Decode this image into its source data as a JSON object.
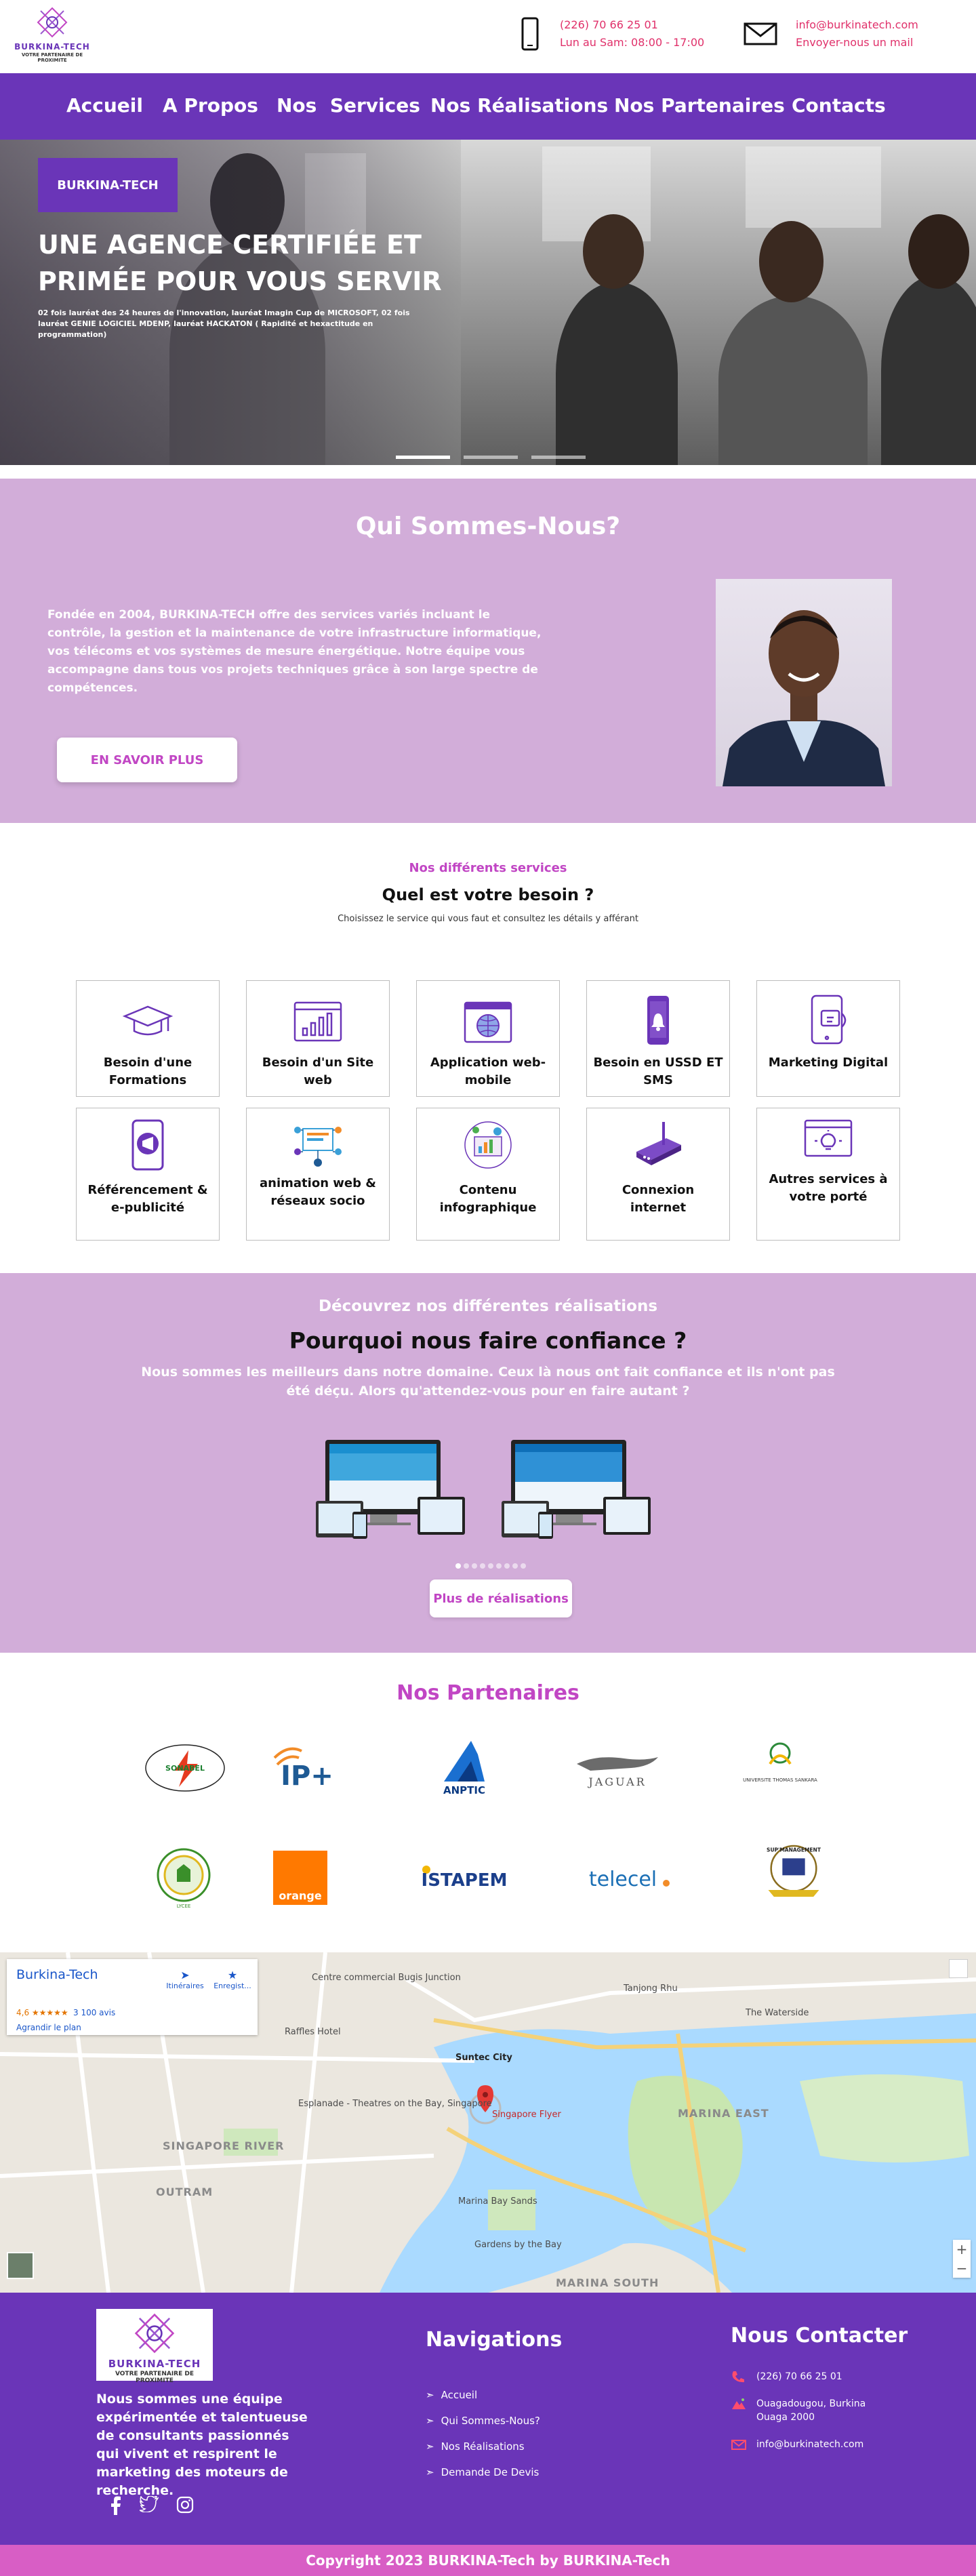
{
  "brand": {
    "name": "BURKINA-TECH",
    "tagline": "VOTRE PARTENAIRE DE PROXIMITE"
  },
  "header": {
    "phone": "(226) 70 66 25 01",
    "hours": "Lun au Sam: 08:00 - 17:00",
    "email": "info@burkinatech.com",
    "email_cta": "Envoyer-nous un mail"
  },
  "nav": {
    "items": [
      "Accueil",
      "A Propos",
      "Nos  Services",
      "Nos Réalisations",
      "Nos Partenaires",
      "Contacts"
    ]
  },
  "hero": {
    "tag": "BURKINA-TECH",
    "title": "UNE AGENCE CERTIFIÉE ET PRIMÉE POUR VOUS SERVIR",
    "subtitle": "02 fois lauréat des 24 heures de l'innovation, lauréat Imagin Cup de MICROSOFT, 02 fois lauréat GENIE LOGICIEL MDENP, lauréat HACKATON ( Rapidité et hexactitude en programmation)",
    "slide_count": 3,
    "active_slide": 1
  },
  "about": {
    "title": "Qui Sommes-Nous?",
    "text": "Fondée en 2004, BURKINA-TECH offre des services variés incluant le contrôle, la gestion et la maintenance de votre infrastructure informatique, vos télécoms et vos systèmes de mesure énergétique. Notre équipe vous accompagne dans tous vos projets techniques grâce à son large spectre de compétences.",
    "button": "EN SAVOIR PLUS"
  },
  "services": {
    "kicker": "Nos différents services",
    "title": "Quel est votre besoin ?",
    "subtitle": "Choisissez le service qui vous faut et consultez les détails y afférant",
    "items": [
      {
        "label": "Besoin d'une Formations",
        "icon": "graduation-cap-icon"
      },
      {
        "label": "Besoin d'un Site web",
        "icon": "website-chart-icon"
      },
      {
        "label": "Application web-mobile",
        "icon": "globe-browser-icon"
      },
      {
        "label": "Besoin en USSD ET SMS",
        "icon": "phone-notification-icon"
      },
      {
        "label": "Marketing Digital",
        "icon": "mobile-marketing-icon"
      },
      {
        "label": "Référencement & e-publicité",
        "icon": "megaphone-phone-icon"
      },
      {
        "label": "animation web & réseaux socio",
        "icon": "social-network-icon"
      },
      {
        "label": "Contenu infographique",
        "icon": "infographic-icon"
      },
      {
        "label": "Connexion internet",
        "icon": "router-icon"
      },
      {
        "label": "Autres services à votre porté",
        "icon": "idea-browser-icon"
      }
    ]
  },
  "realisations": {
    "kicker": "Découvrez nos différentes réalisations",
    "title": "Pourquoi nous faire confiance ?",
    "subtitle": "Nous sommes les meilleurs dans notre domaine. Ceux là nous ont fait confiance et ils n'ont pas été déçu. Alors qu'attendez-vous pour en faire autant ?",
    "button": "Plus de réalisations",
    "dot_count": 9,
    "active_dot": 1
  },
  "partners": {
    "title": "Nos Partenaires",
    "logos": [
      "SONABEL",
      "IP+",
      "ANPTIC",
      "JAGUAR",
      "UNIVERSITE THOMAS SANKARA",
      "LYCEE",
      "orange",
      "ISTAPEM",
      "telecel",
      "SUP'MANAGEMENT"
    ]
  },
  "map": {
    "place": "Burkina-Tech",
    "rating": "4,6 ★★★★★",
    "reviews": "3 100 avis",
    "enlarge": "Agrandir le plan",
    "directions": "Itinéraires",
    "save": "Enregist...",
    "labels": [
      "Centre commercial Bugis Junction",
      "Raffles Hotel",
      "Suntec City",
      "Esplanade - Theatres on the Bay, Singapore",
      "Singapore Flyer",
      "MARINA EAST",
      "Marina Bay Sands",
      "Gardens by the Bay",
      "SINGAPORE RIVER",
      "OUTRAM",
      "The Waterside",
      "Tanjong Rhu",
      "MARINA SOUTH"
    ]
  },
  "footer": {
    "about": "Nous sommes une équipe expérimentée et talentueuse de consultants passionnés qui vivent et respirent le marketing des moteurs de recherche.",
    "nav_title": "Navigations",
    "nav_items": [
      "Accueil",
      "Qui Sommes-Nous?",
      "Nos Réalisations",
      "Demande De Devis"
    ],
    "contact_title": "Nous Contacter",
    "contact_phone": "(226) 70 66 25 01",
    "contact_address_1": "Ouagadougou, Burkina",
    "contact_address_2": "Ouaga 2000",
    "contact_email": "info@burkinatech.com",
    "copyright": "Copyright 2023 BURKINA-Tech by BURKINA-Tech"
  },
  "colors": {
    "primary": "#6a35b8",
    "lilac": "#d2add9",
    "accent": "#c146c4",
    "contact_red": "#e0306a",
    "copyright_pink": "#d85ec5"
  }
}
